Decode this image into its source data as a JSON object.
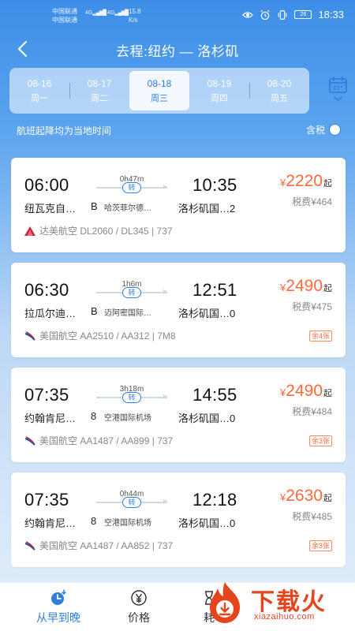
{
  "status_bar": {
    "carrier1": "中国联通",
    "carrier2": "中国联通",
    "signal1": "4G",
    "signal2": "4G",
    "speed_value": "15.8",
    "speed_unit": "K/s",
    "battery": "26",
    "time": "18:33"
  },
  "header": {
    "title": "去程:纽约 — 洛杉矶"
  },
  "date_tabs": [
    {
      "date": "08-16",
      "weekday": "周一"
    },
    {
      "date": "08-17",
      "weekday": "周二"
    },
    {
      "date": "08-18",
      "weekday": "周三",
      "selected": true
    },
    {
      "date": "08-19",
      "weekday": "周四"
    },
    {
      "date": "08-20",
      "weekday": "周五"
    }
  ],
  "note": "航班起降均为当地时间",
  "tax_toggle_label": "含税",
  "flights": [
    {
      "dep_time": "06:00",
      "dep_airport": "纽瓦克自…",
      "dep_terminal": "B",
      "duration": "0h47m",
      "transfer": "转",
      "via": "哈茨菲尔德…",
      "arr_time": "10:35",
      "arr_airport": "洛杉矶国…2",
      "price_currency": "¥",
      "price": "2220",
      "price_suffix": "起",
      "tax": "税费¥464",
      "seats_left": "",
      "airline": "达美航空 DL2060 / DL345 | 737",
      "airline_logo": "delta-logo"
    },
    {
      "dep_time": "06:30",
      "dep_airport": "拉瓜尔迪…",
      "dep_terminal": "B",
      "duration": "1h6m",
      "transfer": "转",
      "via": "迈阿密国际…",
      "arr_time": "12:51",
      "arr_airport": "洛杉矶国…0",
      "price_currency": "¥",
      "price": "2490",
      "price_suffix": "起",
      "tax": "税费¥475",
      "seats_left": "余4张",
      "airline": "美国航空 AA2510 / AA312 | 7M8",
      "airline_logo": "american-airlines-logo"
    },
    {
      "dep_time": "07:35",
      "dep_airport": "约翰肯尼…",
      "dep_terminal": "8",
      "duration": "3h18m",
      "transfer": "转",
      "via": "空港国际机场",
      "arr_time": "14:55",
      "arr_airport": "洛杉矶国…0",
      "price_currency": "¥",
      "price": "2490",
      "price_suffix": "起",
      "tax": "税费¥484",
      "seats_left": "余3张",
      "airline": "美国航空 AA1487 / AA899 | 737",
      "airline_logo": "american-airlines-logo"
    },
    {
      "dep_time": "07:35",
      "dep_airport": "约翰肯尼…",
      "dep_terminal": "8",
      "duration": "0h44m",
      "transfer": "转",
      "via": "空港国际机场",
      "arr_time": "12:18",
      "arr_airport": "洛杉矶国…0",
      "price_currency": "¥",
      "price": "2630",
      "price_suffix": "起",
      "tax": "税费¥485",
      "seats_left": "余3张",
      "airline": "美国航空 AA1487 / AA852 | 737",
      "airline_logo": "american-airlines-logo"
    }
  ],
  "tabbar": {
    "tab1": "从早到晚",
    "tab2": "价格",
    "tab3": "耗"
  },
  "watermark": {
    "text": "下载火",
    "url": "xiazaihuo.com"
  },
  "colors": {
    "accent": "#2f7fe0",
    "price": "#ff6a3d",
    "watermark": "#e6441c"
  }
}
